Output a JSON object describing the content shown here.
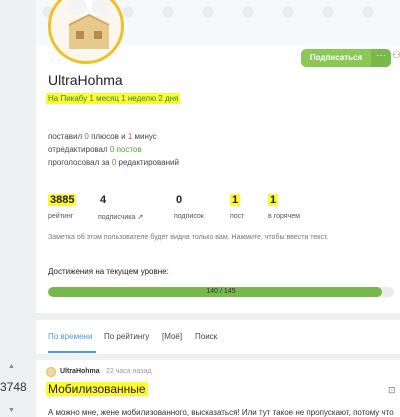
{
  "profile": {
    "username": "UltraHohma",
    "on_pikabu": "На Пикабу 1 месяц 1 неделю 2 дня",
    "subscribe_label": "Подписаться",
    "more_label": "···",
    "activity": {
      "line1_prefix": "поставил ",
      "line1_plus_count": "0",
      "line1_mid": " плюсов и ",
      "line1_minus_count": "1",
      "line1_suffix": " минус",
      "line2_prefix": "отредактировал ",
      "line2_posts": "0 постов",
      "line3_prefix": "проголосовал за ",
      "line3_count": "0",
      "line3_suffix": " редактирований"
    },
    "counters": [
      {
        "value": "3885",
        "label": "рейтинг"
      },
      {
        "value": "4",
        "label": "подписчика"
      },
      {
        "value": "0",
        "label": "подписок"
      },
      {
        "value": "1",
        "label": "пост"
      },
      {
        "value": "1",
        "label": "в горячем"
      }
    ],
    "note": "Заметка об этом пользователе будет видна только вам. Нажмите, чтобы ввести текст."
  },
  "level": {
    "title": "Достижения на текущем уровне:",
    "progress_text": "140 / 145",
    "progress_fraction": 0.966
  },
  "tabs": [
    "По времени",
    "По рейтингу",
    "[Моё]",
    "Поиск"
  ],
  "rail": {
    "count": "3748"
  },
  "post": {
    "author": "UltraHohma",
    "time": "22 часа назад",
    "title": "Мобилизованные",
    "text": "А можно мне, жене мобилизованного, высказаться! Или тут такое не пропускают, потому что"
  },
  "colors": {
    "accent_green": "#8ac858",
    "highlight_yellow": "#fff933",
    "tab_blue": "#4a9bd8",
    "avatar_ring": "#f0c02a"
  },
  "icons": {
    "more": "ellipsis-icon",
    "save": "bookmark-icon",
    "note_external": "external-link-icon"
  }
}
